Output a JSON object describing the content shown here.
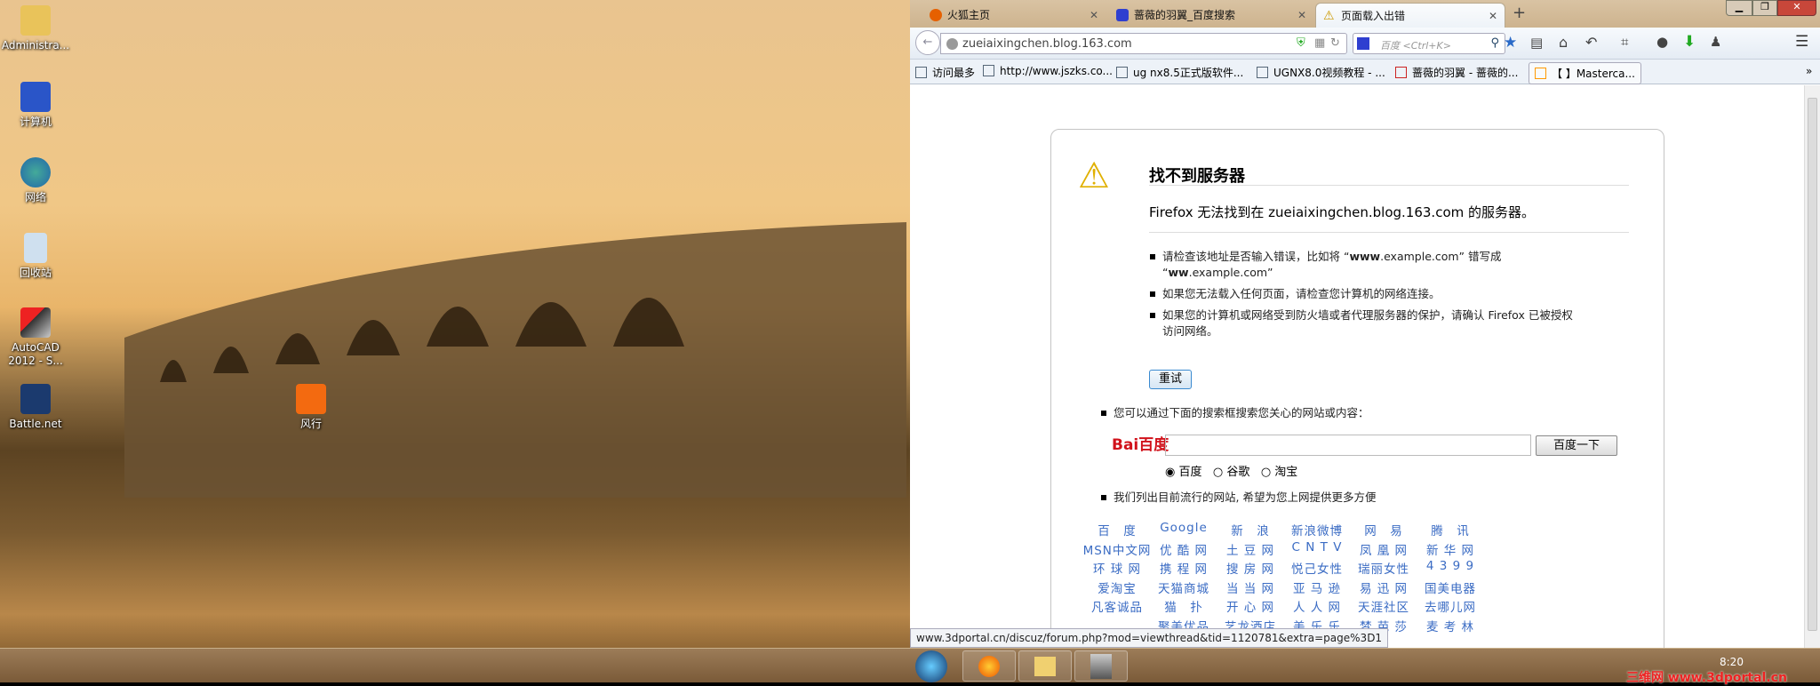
{
  "desktop": {
    "icons": [
      {
        "label": "Administra...",
        "icon": "user-folder-icon"
      },
      {
        "label": "计算机",
        "icon": "computer-icon"
      },
      {
        "label": "网络",
        "icon": "network-icon"
      },
      {
        "label": "回收站",
        "icon": "recycle-bin-icon"
      },
      {
        "label": "AutoCAD",
        "label2": "2012 - S...",
        "icon": "autocad-icon"
      },
      {
        "label": "Battle.net",
        "icon": "battlenet-icon"
      },
      {
        "label": "风行",
        "icon": "funshion-icon"
      }
    ]
  },
  "browser": {
    "tabs": [
      {
        "label": "火狐主页"
      },
      {
        "label": "蔷薇的羽翼_百度搜索"
      },
      {
        "label": "页面载入出错",
        "active": true
      }
    ],
    "url": "zueiaixingchen.blog.163.com",
    "search_placeholder": "百度 <Ctrl+K>",
    "bookmarks": [
      "访问最多",
      "http://www.jszks.co...",
      "ug nx8.5正式版软件...",
      "UGNX8.0视频教程 - ...",
      "蔷薇的羽翼 - 蔷薇的...",
      "【          】Masterca..."
    ],
    "status_url": "www.3dportal.cn/discuz/forum.php?mod=viewthread&tid=1120781&extra=page%3D1"
  },
  "error": {
    "title": "找不到服务器",
    "desc": "Firefox 无法找到在 zueiaixingchen.blog.163.com 的服务器。",
    "bullet1a": "请检查该地址是否输入错误，比如将 “",
    "bullet1b": "www",
    "bullet1c": ".example.com” 错写成",
    "bullet1d": "“",
    "bullet1e": "ww",
    "bullet1f": ".example.com”",
    "bullet2": "如果您无法载入任何页面，请检查您计算机的网络连接。",
    "bullet3": "如果您的计算机或网络受到防火墙或者代理服务器的保护，请确认 Firefox 已被授权访问网络。",
    "retry": "重试",
    "search_hint": "您可以通过下面的搜索框搜索您关心的网站或内容：",
    "baidu_logo": "Bai百度",
    "search_button": "百度一下",
    "engines": [
      "百度",
      "谷歌",
      "淘宝"
    ],
    "sites_hint": "我们列出目前流行的网站, 希望为您上网提供更多方便",
    "sites": [
      [
        "百　度",
        "Google",
        "新　浪",
        "新浪微博",
        "网　易",
        "腾　讯"
      ],
      [
        "MSN中文网",
        "优 酷 网",
        "土 豆 网",
        "C N T V",
        "凤 凰 网",
        "新 华 网"
      ],
      [
        "环 球 网",
        "携 程 网",
        "搜 房 网",
        "悦己女性",
        "瑞丽女性",
        "4 3 9 9"
      ],
      [
        "爱淘宝",
        "天猫商城",
        "当 当 网",
        "亚 马 逊",
        "易 迅 网",
        "国美电器"
      ],
      [
        "凡客诚品",
        "猫　扑",
        "开 心 网",
        "人 人 网",
        "天涯社区",
        "去哪儿网"
      ],
      [
        "",
        "聚美优品",
        "艺龙酒店",
        "美 乐 乐",
        "梦 芭 莎",
        "麦 考 林"
      ]
    ]
  },
  "taskbar": {
    "clock": "8:20",
    "watermark": "三维网 www.3dportal.cn"
  }
}
